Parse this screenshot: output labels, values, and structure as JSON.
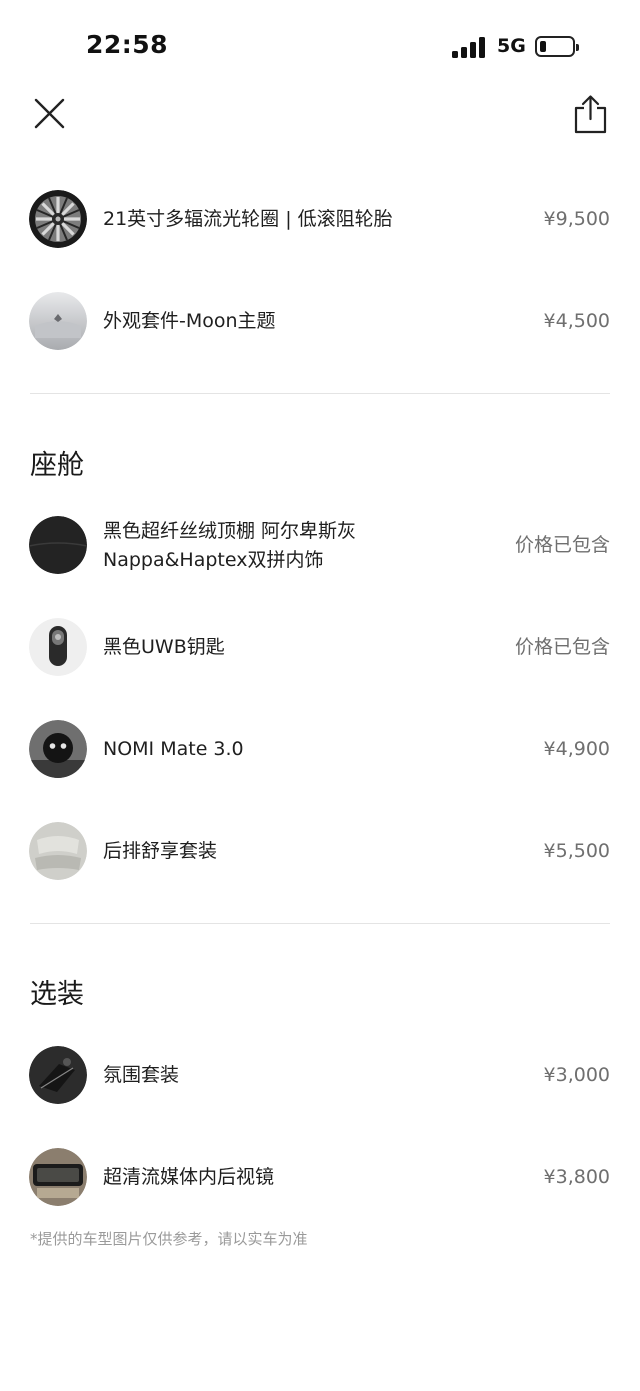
{
  "status_bar": {
    "time": "22:58",
    "network": "5G",
    "battery_level": 0.2
  },
  "header": {
    "close_icon": "close-icon",
    "share_icon": "share-icon"
  },
  "exterior_items": [
    {
      "name": "21英寸多辐流光轮圈 | 低滚阻轮胎",
      "price": "¥9,500",
      "icon": "wheel-thumbnail"
    },
    {
      "name": "外观套件-Moon主题",
      "price": "¥4,500",
      "icon": "exterior-kit-thumbnail"
    }
  ],
  "cabin": {
    "title": "座舱",
    "items": [
      {
        "name_line1": "黑色超纤丝绒顶棚 阿尔卑斯灰",
        "name_line2": "Nappa&Haptex双拼内饰",
        "price": "价格已包含",
        "icon": "interior-thumbnail"
      },
      {
        "name": "黑色UWB钥匙",
        "price": "价格已包含",
        "icon": "key-thumbnail"
      },
      {
        "name": "NOMI Mate 3.0",
        "price": "¥4,900",
        "icon": "nomi-thumbnail"
      },
      {
        "name": "后排舒享套装",
        "price": "¥5,500",
        "icon": "rear-seat-thumbnail"
      }
    ]
  },
  "options": {
    "title": "选装",
    "items": [
      {
        "name": "氛围套装",
        "price": "¥3,000",
        "icon": "ambient-thumbnail"
      },
      {
        "name": "超清流媒体内后视镜",
        "price": "¥3,800",
        "icon": "mirror-thumbnail"
      }
    ]
  },
  "disclaimer": "*提供的车型图片仅供参考，请以实车为准"
}
